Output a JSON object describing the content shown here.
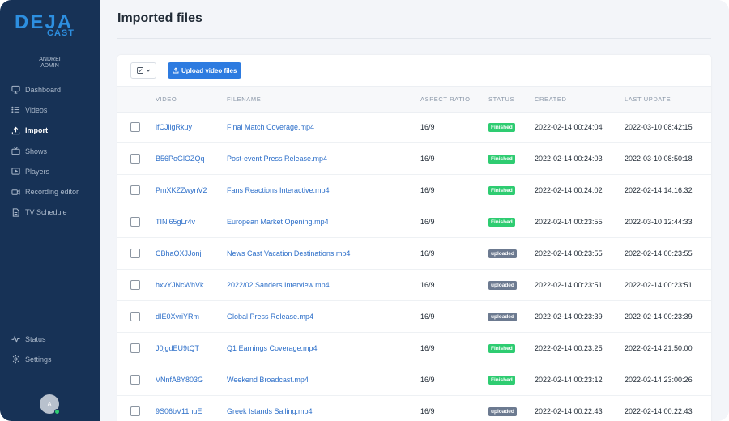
{
  "brand": {
    "logo_top": "DEJA",
    "logo_bottom": "CAST",
    "color": "#2d8fe0"
  },
  "user": {
    "name": "ANDREI",
    "role": "ADMIN",
    "avatar_initial": "A"
  },
  "sidebar": {
    "items": [
      {
        "label": "Dashboard",
        "icon": "monitor-icon"
      },
      {
        "label": "Videos",
        "icon": "list-icon"
      },
      {
        "label": "Import",
        "icon": "upload-icon",
        "active": true
      },
      {
        "label": "Shows",
        "icon": "tv-icon"
      },
      {
        "label": "Players",
        "icon": "play-icon"
      },
      {
        "label": "Recording editor",
        "icon": "camera-icon"
      },
      {
        "label": "TV Schedule",
        "icon": "document-icon"
      }
    ],
    "bottom": [
      {
        "label": "Status",
        "icon": "pulse-icon"
      },
      {
        "label": "Settings",
        "icon": "gear-icon"
      }
    ]
  },
  "page": {
    "title": "Imported files"
  },
  "toolbar": {
    "upload_label": "Upload video files"
  },
  "table": {
    "columns": [
      "VIDEO",
      "FILENAME",
      "ASPECT RATIO",
      "STATUS",
      "CREATED",
      "LAST UPDATE"
    ],
    "rows": [
      {
        "video": "ifCJilgRkuy",
        "filename": "Final Match Coverage.mp4",
        "aspect": "16/9",
        "status": "Finished",
        "created": "2022-02-14 00:24:04",
        "updated": "2022-03-10 08:42:15"
      },
      {
        "video": "B56PoGlOZQq",
        "filename": "Post-event Press Release.mp4",
        "aspect": "16/9",
        "status": "Finished",
        "created": "2022-02-14 00:24:03",
        "updated": "2022-03-10 08:50:18"
      },
      {
        "video": "PmXKZZwynV2",
        "filename": "Fans Reactions Interactive.mp4",
        "aspect": "16/9",
        "status": "Finished",
        "created": "2022-02-14 00:24:02",
        "updated": "2022-02-14 14:16:32"
      },
      {
        "video": "TINl65gLr4v",
        "filename": "European Market Opening.mp4",
        "aspect": "16/9",
        "status": "Finished",
        "created": "2022-02-14 00:23:55",
        "updated": "2022-03-10 12:44:33"
      },
      {
        "video": "CBhaQXJJonj",
        "filename": "News Cast Vacation Destinations.mp4",
        "aspect": "16/9",
        "status": "uploaded",
        "created": "2022-02-14 00:23:55",
        "updated": "2022-02-14 00:23:55"
      },
      {
        "video": "hxvYJNcWhVk",
        "filename": "2022/02 Sanders Interview.mp4",
        "aspect": "16/9",
        "status": "uploaded",
        "created": "2022-02-14 00:23:51",
        "updated": "2022-02-14 00:23:51"
      },
      {
        "video": "dIE0XvriYRm",
        "filename": "Global Press Release.mp4",
        "aspect": "16/9",
        "status": "uploaded",
        "created": "2022-02-14 00:23:39",
        "updated": "2022-02-14 00:23:39"
      },
      {
        "video": "J0jgdEU9tQT",
        "filename": "Q1 Earnings Coverage.mp4",
        "aspect": "16/9",
        "status": "Finished",
        "created": "2022-02-14 00:23:25",
        "updated": "2022-02-14 21:50:00"
      },
      {
        "video": "VNnfA8Y803G",
        "filename": "Weekend Broadcast.mp4",
        "aspect": "16/9",
        "status": "Finished",
        "created": "2022-02-14 00:23:12",
        "updated": "2022-02-14 23:00:26"
      },
      {
        "video": "9S06bV11nuE",
        "filename": "Greek Istands Sailing.mp4",
        "aspect": "16/9",
        "status": "uploaded",
        "created": "2022-02-14 00:22:43",
        "updated": "2022-02-14 00:22:43"
      }
    ]
  },
  "colors": {
    "sidebar_bg": "#173256",
    "accent": "#2d7be0",
    "finished": "#2ecc71",
    "uploaded": "#6c7a90"
  }
}
